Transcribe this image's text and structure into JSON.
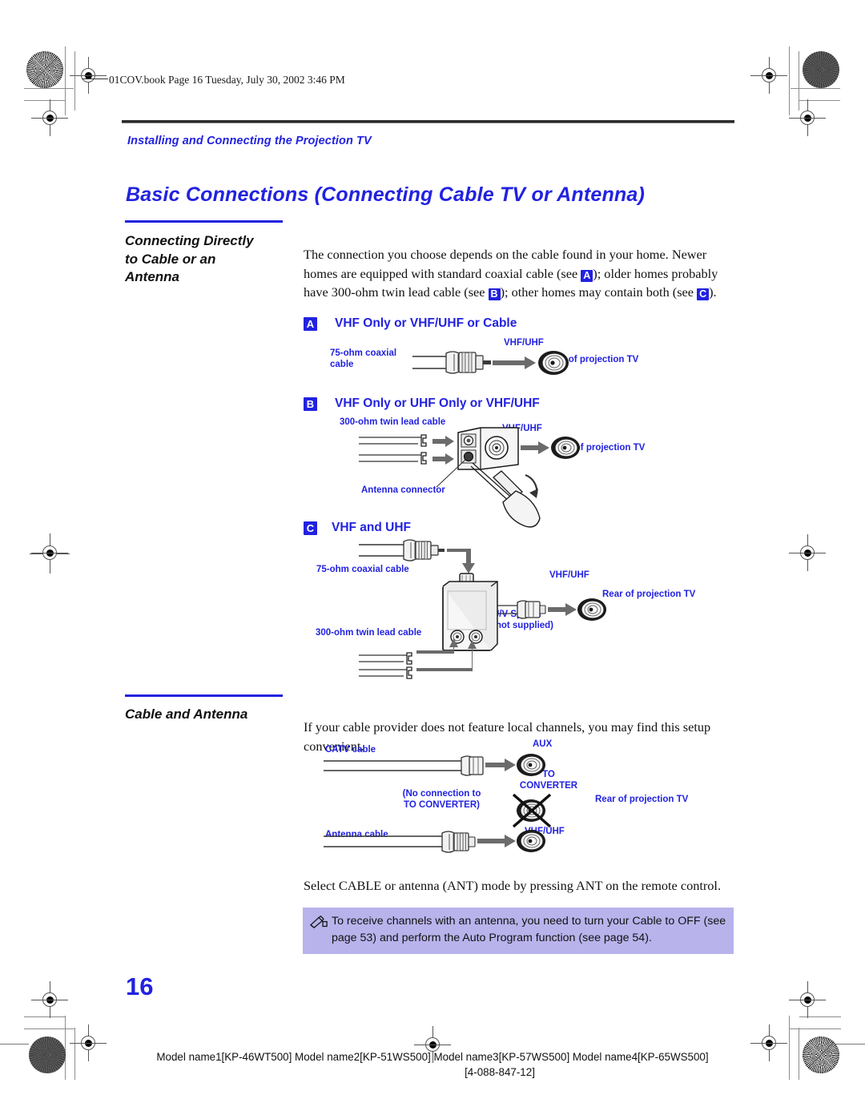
{
  "print_marks": {
    "file_stamp": "01COV.book  Page 16  Tuesday, July 30, 2002  3:46 PM"
  },
  "header": {
    "running_head": "Installing and Connecting the Projection TV",
    "title": "Basic Connections (Connecting Cable TV or Antenna)"
  },
  "sections": [
    {
      "heading": "Connecting Directly\nto Cable or an\nAntenna",
      "intro_parts": {
        "p1": "The connection you choose depends on the cable found in your home. Newer homes are equipped with standard coaxial cable (see ",
        "tagA": "A",
        "p2": "); older homes probably have 300-ohm twin lead cable (see ",
        "tagB": "B",
        "p3": "); other homes may contain both (see ",
        "tagC": "C",
        "p4": ")."
      }
    },
    {
      "heading": "Cable and Antenna",
      "intro": "If your cable provider does not feature local channels, you may find this setup convenient.",
      "outro": "Select CABLE or antenna (ANT) mode by pressing ANT on the remote control."
    }
  ],
  "figures": {
    "a": {
      "tag": "A",
      "caption": "VHF Only or VHF/UHF or Cable",
      "labels": {
        "cable": "75-ohm coaxial\ncable",
        "port": "VHF/UHF",
        "tv": "Rear of projection TV"
      }
    },
    "b": {
      "tag": "B",
      "caption": "VHF Only or UHF Only or VHF/UHF",
      "labels": {
        "cable": "300-ohm twin lead cable",
        "port": "VHF/UHF",
        "tv": "Rear of projection TV",
        "connector": "Antenna connector"
      }
    },
    "c": {
      "tag": "C",
      "caption": "VHF and UHF",
      "labels": {
        "coax": "75-ohm coaxial cable",
        "twinlead": "300-ohm twin lead cable",
        "splitter": "U/V Splitter\n(not supplied)",
        "port": "VHF/UHF",
        "tv": "Rear of projection TV"
      }
    },
    "d": {
      "labels": {
        "catv": "CATV cable",
        "aux": "AUX",
        "to_converter": "TO\nCONVERTER",
        "no_connection": "(No connection to\nTO CONVERTER)",
        "tv": "Rear of projection TV",
        "antenna_cable": "Antenna cable",
        "vhfuhf": "VHF/UHF"
      }
    }
  },
  "note": {
    "icon": "pencil-note-icon",
    "text": "To receive channels with an antenna, you need to turn your Cable to OFF (see page 53) and perform the Auto Program function (see page 54)."
  },
  "footer": {
    "page_number": "16",
    "models": "Model name1[KP-46WT500] Model name2[KP-51WS500] Model name3[KP-57WS500] Model name4[KP-65WS500]",
    "doc_number": "[4-088-847-12]"
  },
  "colors": {
    "accent_blue": "#2222e0",
    "note_bg": "#b9b3ec",
    "rule_dark": "#2b2b2b",
    "diagram_gray": "#6b6b6b"
  }
}
